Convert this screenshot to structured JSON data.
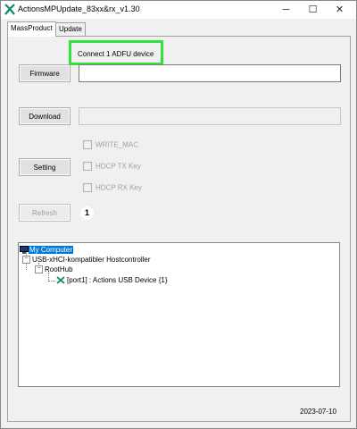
{
  "window": {
    "title": "ActionsMPUpdate_83xx&rx_v1.30",
    "minimize_glyph": "─",
    "maximize_glyph": "☐",
    "close_glyph": "✕",
    "app_icon": "actions-x-icon",
    "icon_color": "#0e8a6c"
  },
  "tabs": [
    {
      "label": "MassProduct",
      "active": true
    },
    {
      "label": "Update",
      "active": false
    }
  ],
  "status": {
    "text": "Connect 1 ADFU device",
    "highlight_color": "#34e13c"
  },
  "buttons": {
    "firmware": "Firmware",
    "download": "Download",
    "setting": "Setting",
    "refresh": "Refresh"
  },
  "fields": {
    "firmware_path": "",
    "download_status": ""
  },
  "checkboxes": [
    {
      "label": "WRITE_MAC",
      "checked": false,
      "enabled": false
    },
    {
      "label": "HDCP TX Key",
      "checked": false,
      "enabled": false
    },
    {
      "label": "HDCP RX Key",
      "checked": false,
      "enabled": false
    }
  ],
  "marker_label": "1",
  "device_tree": {
    "root": "My Computer",
    "controller": "USB-xHCI-kompatibler Hostcontroller",
    "hub": "RootHub",
    "device": "[port1] : Actions USB Device {1}",
    "selected_color": "#0078d7"
  },
  "footer": {
    "date": "2023-07-10"
  }
}
